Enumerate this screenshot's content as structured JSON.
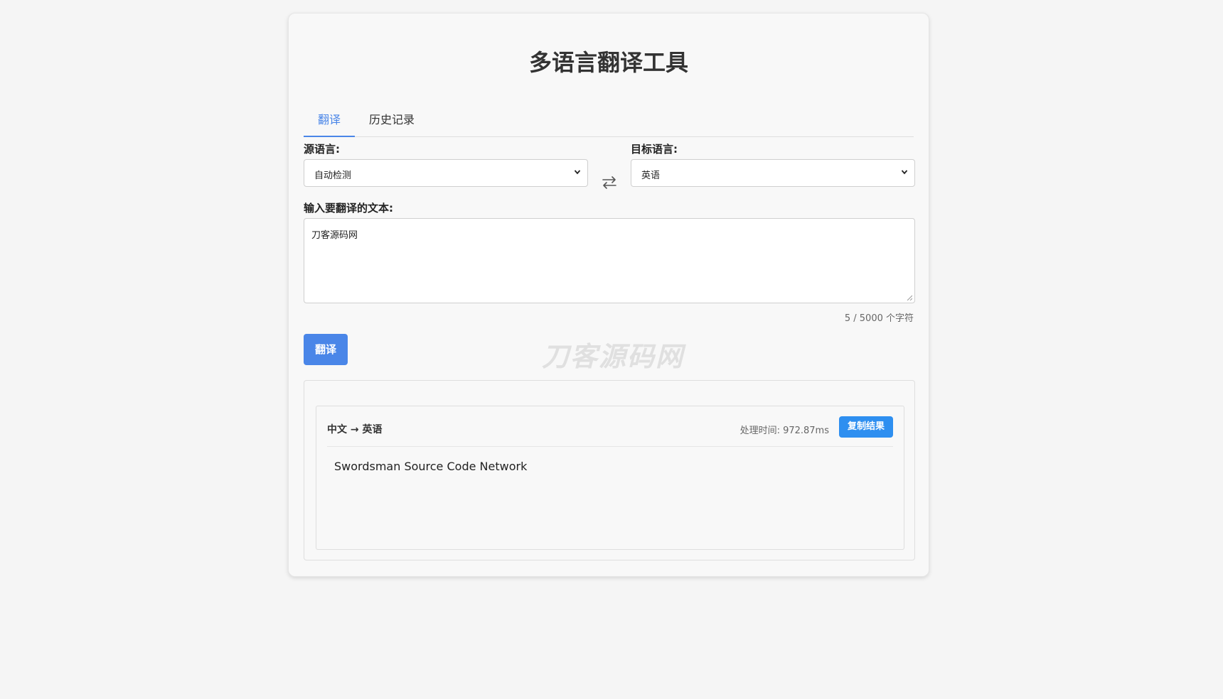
{
  "header": {
    "title": "多语言翻译工具"
  },
  "tabs": [
    {
      "label": "翻译"
    },
    {
      "label": "历史记录"
    }
  ],
  "source": {
    "label": "源语言:",
    "selected": "自动检测"
  },
  "target": {
    "label": "目标语言:",
    "selected": "英语"
  },
  "input": {
    "label": "输入要翻译的文本:",
    "value": "刀客源码网",
    "counter": "5 / 5000 个字符"
  },
  "actions": {
    "translate_label": "翻译"
  },
  "watermark": {
    "text": "刀客源码网"
  },
  "result": {
    "lang_pair": "中文 → 英语",
    "processing_time": "处理时间: 972.87ms",
    "copy_label": "复制结果",
    "text": "Swordsman Source Code Network"
  },
  "colors": {
    "accent": "#4a86e8",
    "copy_button": "#2e8ff0",
    "background": "#f5f5f5"
  },
  "icons": {
    "swap": "swap-arrows-icon",
    "dropdown": "chevron-down-icon"
  }
}
